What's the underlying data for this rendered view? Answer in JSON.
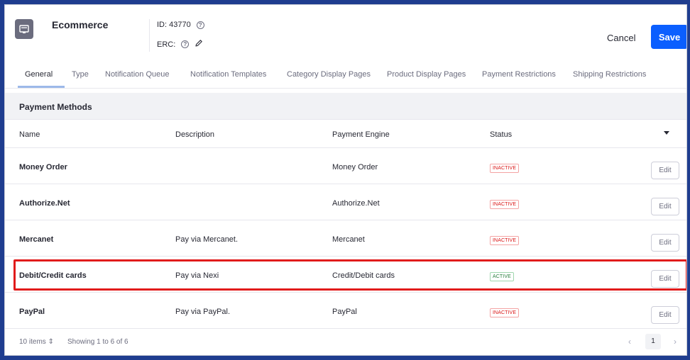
{
  "header": {
    "app_title": "Ecommerce",
    "id_label": "ID: 43770",
    "erc_label": "ERC:",
    "icon": "app-card-icon",
    "cancel_label": "Cancel",
    "save_label": "Save"
  },
  "tabs": [
    {
      "label": "General",
      "active": true
    },
    {
      "label": "Type"
    },
    {
      "label": "Notification Queue"
    },
    {
      "label": "Notification Templates"
    },
    {
      "label": "Category Display Pages"
    },
    {
      "label": "Product Display Pages"
    },
    {
      "label": "Payment Restrictions"
    },
    {
      "label": "Shipping Restrictions"
    }
  ],
  "section": {
    "title": "Payment Methods"
  },
  "table": {
    "columns": [
      "Name",
      "Description",
      "Payment Engine",
      "Status"
    ],
    "rows": [
      {
        "name": "Money Order",
        "description": "",
        "engine": "Money Order",
        "status": "INACTIVE",
        "edit": "Edit"
      },
      {
        "name": "Authorize.Net",
        "description": "",
        "engine": "Authorize.Net",
        "status": "INACTIVE",
        "edit": "Edit"
      },
      {
        "name": "Mercanet",
        "description": "Pay via Mercanet.",
        "engine": "Mercanet",
        "status": "INACTIVE",
        "edit": "Edit"
      },
      {
        "name": "Debit/Credit cards",
        "description": "Pay via Nexi",
        "engine": "Credit/Debit cards",
        "status": "ACTIVE",
        "edit": "Edit"
      },
      {
        "name": "PayPal",
        "description": "Pay via PayPal.",
        "engine": "PayPal",
        "status": "INACTIVE",
        "edit": "Edit"
      }
    ]
  },
  "footer": {
    "items_per_page": "10 items",
    "showing": "Showing 1 to 6 of 6",
    "current_page": "1"
  },
  "colors": {
    "accent": "#0b5fff",
    "highlight": "#e11b1b",
    "inactive": "#da1414",
    "active": "#287d3c"
  }
}
